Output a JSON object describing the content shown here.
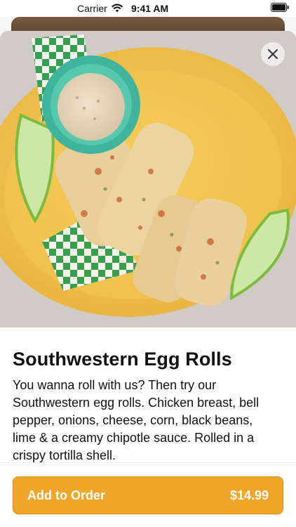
{
  "status_bar": {
    "carrier": "Carrier",
    "time": "9:41 AM"
  },
  "item": {
    "title": "Southwestern Egg Rolls",
    "description": "You wanna roll with us? Then try our Southwestern egg rolls. Chicken breast, bell pepper, onions, cheese, corn, black beans, lime & a creamy chipotle sauce. Rolled in a crispy tortilla shell.",
    "image_alt": "Southwestern Egg Rolls"
  },
  "order_button": {
    "label": "Add to Order",
    "price": "$14.99"
  },
  "colors": {
    "accent": "#f0a628",
    "accent_border": "#d98d12",
    "plate": "#f2c94c",
    "bowl": "#3fb39c"
  },
  "icons": {
    "close": "close-icon",
    "wifi": "wifi-icon",
    "battery": "battery-icon"
  }
}
